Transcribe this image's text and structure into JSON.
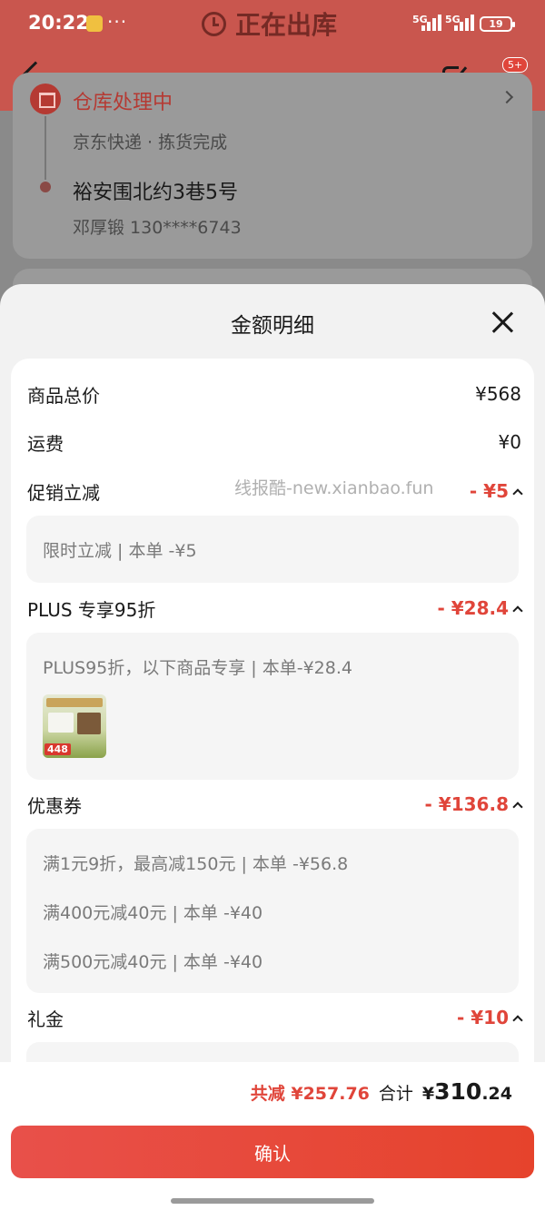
{
  "status_bar": {
    "time": "20:22",
    "network_1": "5G",
    "network_2": "5G",
    "battery": "19"
  },
  "page": {
    "status_title": "正在出库",
    "more_badge": "5+",
    "warehouse_status": "仓库处理中",
    "courier": "京东快递 · 拣货完成",
    "address": "裕安围北约3巷5号",
    "recipient": "邓厚锻 130****6743"
  },
  "sheet": {
    "title": "金额明细",
    "watermark": "线报酷-new.xianbao.fun",
    "rows": {
      "goods_total": {
        "label": "商品总价",
        "value": "¥568"
      },
      "shipping": {
        "label": "运费",
        "value": "¥0"
      },
      "promo": {
        "label": "促销立减",
        "value": "- ¥5",
        "details": [
          "限时立减 | 本单 -¥5"
        ]
      },
      "plus": {
        "label": "PLUS 专享95折",
        "value": "- ¥28.4",
        "details": [
          "PLUS95折，以下商品专享 | 本单-¥28.4"
        ],
        "product_price_tag": "448"
      },
      "coupon": {
        "label": "优惠券",
        "value": "- ¥136.8",
        "details": [
          "满1元9折，最高减150元 | 本单 -¥56.8",
          "满400元减40元 | 本单 -¥40",
          "满500元减40元 | 本单 -¥40"
        ]
      },
      "gift": {
        "label": "礼金",
        "value": "- ¥10"
      }
    }
  },
  "footer": {
    "saved": "共减 ¥257.76",
    "total_label": "合计",
    "total_currency": "¥",
    "total_int": "310",
    "total_dec": ".24",
    "confirm_label": "确认"
  },
  "colors": {
    "accent_red": "#e0453a",
    "header_bg": "#c9564e"
  }
}
